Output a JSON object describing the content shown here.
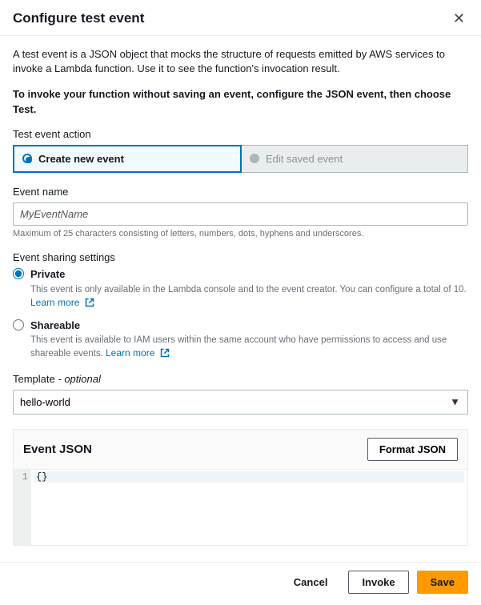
{
  "header": {
    "title": "Configure test event"
  },
  "intro": {
    "p1": "A test event is a JSON object that mocks the structure of requests emitted by AWS services to invoke a Lambda function. Use it to see the function's invocation result.",
    "p2": "To invoke your function without saving an event, configure the JSON event, then choose Test."
  },
  "action": {
    "label": "Test event action",
    "create": "Create new event",
    "edit": "Edit saved event"
  },
  "event_name": {
    "label": "Event name",
    "value": "MyEventName",
    "hint": "Maximum of 25 characters consisting of letters, numbers, dots, hyphens and underscores."
  },
  "sharing": {
    "label": "Event sharing settings",
    "private": {
      "title": "Private",
      "desc": "This event is only available in the Lambda console and to the event creator. You can configure a total of 10.",
      "learn": "Learn more"
    },
    "shareable": {
      "title": "Shareable",
      "desc": "This event is available to IAM users within the same account who have permissions to access and use shareable events.",
      "learn": "Learn more"
    }
  },
  "template": {
    "label": "Template",
    "optional": "- optional",
    "value": "hello-world"
  },
  "json": {
    "heading": "Event JSON",
    "format_btn": "Format JSON",
    "line_no": "1",
    "content": "{}"
  },
  "footer": {
    "cancel": "Cancel",
    "invoke": "Invoke",
    "save": "Save"
  }
}
